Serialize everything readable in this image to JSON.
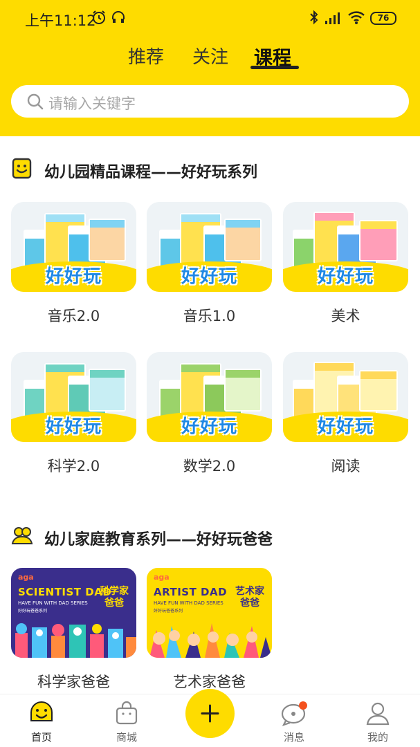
{
  "status_bar": {
    "time": "上午11:12",
    "battery": "76"
  },
  "tabs": [
    {
      "label": "推荐",
      "active": false
    },
    {
      "label": "关注",
      "active": false
    },
    {
      "label": "课程",
      "active": true
    }
  ],
  "search": {
    "placeholder": "请输入关键字"
  },
  "section1": {
    "title": "幼儿园精品课程——好好玩系列",
    "logo_text": "好好玩",
    "courses": [
      {
        "label": "音乐2.0"
      },
      {
        "label": "音乐1.0"
      },
      {
        "label": "美术"
      },
      {
        "label": "科学2.0"
      },
      {
        "label": "数学2.0"
      },
      {
        "label": "阅读"
      }
    ]
  },
  "section2": {
    "title": "幼儿家庭教育系列——好好玩爸爸",
    "items": [
      {
        "label": "科学家爸爸",
        "card_title": "SCIENTIST DAD",
        "card_sub": "HAVE FUN WITH DAD SERIES",
        "card_sub2": "好好玩爸爸系列",
        "card_cn": "科学家 爸爸",
        "brand": "aga"
      },
      {
        "label": "艺术家爸爸",
        "card_title": "ARTIST DAD",
        "card_sub": "HAVE FUN WITH DAD  SERIES",
        "card_sub2": "好好玩爸爸系列",
        "card_cn": "艺术家 爸爸",
        "brand": "aga"
      }
    ]
  },
  "navbar": [
    {
      "label": "首页",
      "icon": "home-icon",
      "active": true
    },
    {
      "label": "商城",
      "icon": "shop-bag-icon",
      "active": false
    },
    {
      "label": "消息",
      "icon": "message-icon",
      "active": false
    },
    {
      "label": "我的",
      "icon": "profile-icon",
      "active": false
    }
  ],
  "colors": {
    "accent": "#FEDC00",
    "badge": "#F4511E",
    "dad_blue": "#3A2E8C"
  }
}
